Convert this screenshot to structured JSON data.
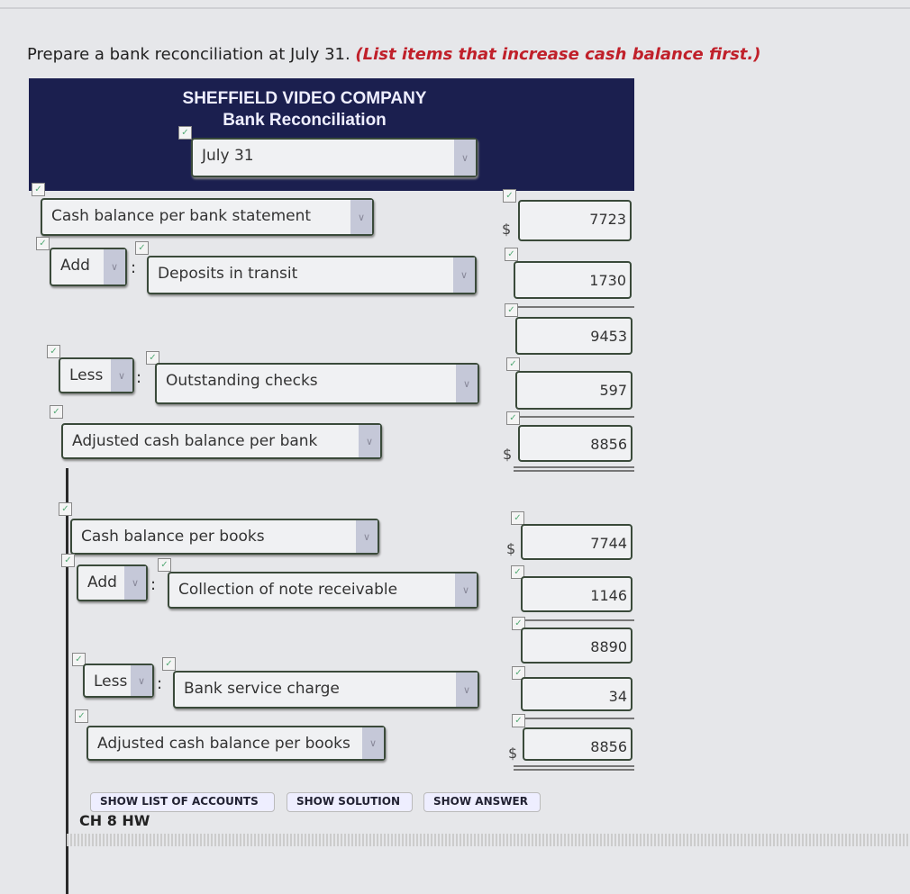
{
  "instruction": {
    "text": "Prepare a bank reconciliation at July 31. ",
    "emphasis": "(List items that increase cash balance first.)"
  },
  "header": {
    "company": "SHEFFIELD VIDEO COMPANY",
    "title": "Bank Reconciliation",
    "date": "July 31"
  },
  "rows": [
    {
      "label": "Cash balance per bank statement",
      "amount": "7723",
      "dollar": "$"
    },
    {
      "op": "Add",
      "label": "Deposits in transit",
      "amount": "1730"
    },
    {
      "amount": "9453"
    },
    {
      "op": "Less",
      "label": "Outstanding checks",
      "amount": "597"
    },
    {
      "label": "Adjusted cash balance per bank",
      "amount": "8856",
      "dollar": "$"
    },
    {
      "label": "Cash balance per books",
      "amount": "7744",
      "dollar": "$"
    },
    {
      "op": "Add",
      "label": "Collection of note receivable",
      "amount": "1146"
    },
    {
      "amount": "8890"
    },
    {
      "op": "Less",
      "label": "Bank service charge",
      "amount": "34"
    },
    {
      "label": "Adjusted cash balance per books",
      "amount": "8856",
      "dollar": "$"
    }
  ],
  "buttons": [
    "SHOW LIST OF ACCOUNTS",
    "SHOW SOLUTION",
    "SHOW ANSWER"
  ],
  "footer": {
    "section": "CH 8 HW"
  },
  "colors": {
    "header": "#1b1f4f",
    "emphasis": "#c0202a"
  }
}
